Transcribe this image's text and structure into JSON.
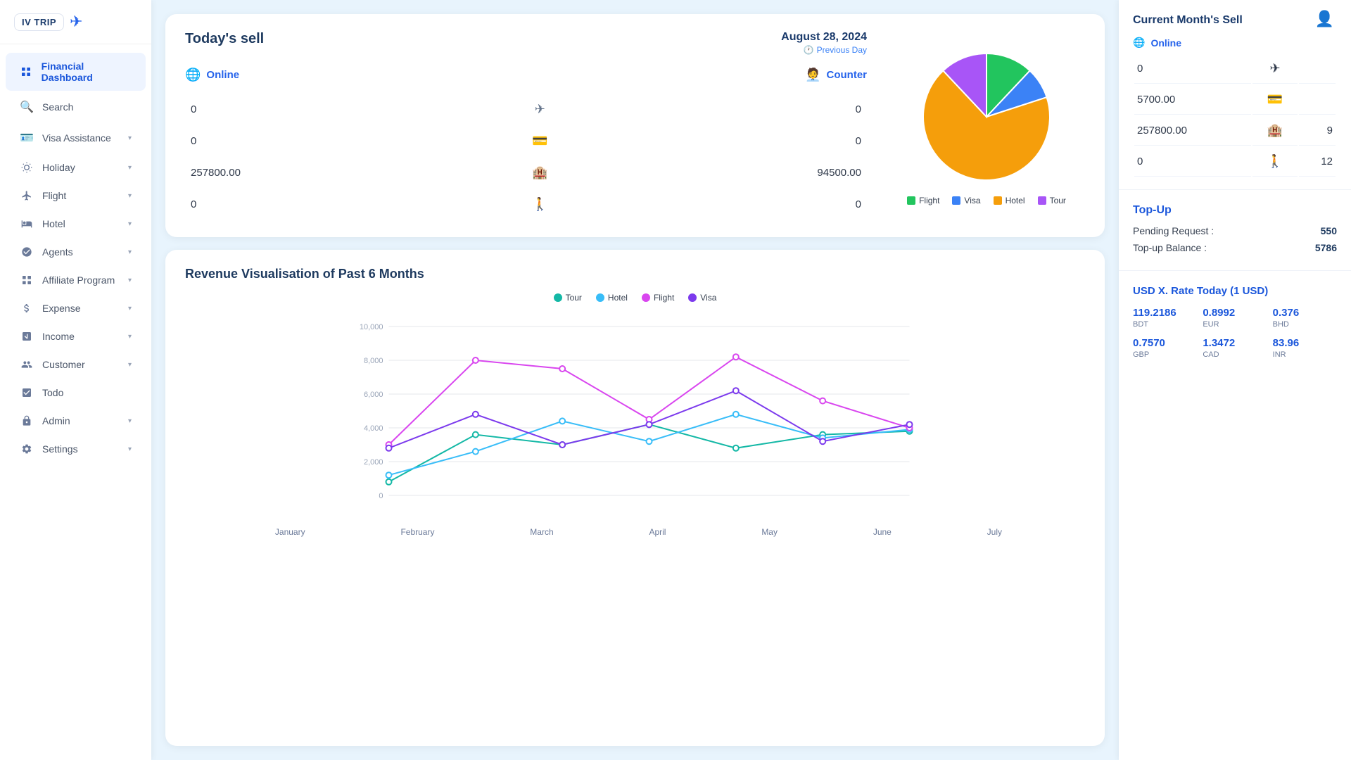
{
  "app": {
    "logo_text": "IV TRIP",
    "logo_icon": "✈"
  },
  "sidebar": {
    "items": [
      {
        "id": "financial-dashboard",
        "label": "Financial Dashboard",
        "icon": "▦",
        "active": true,
        "chevron": false
      },
      {
        "id": "search",
        "label": "Search",
        "icon": "🔍",
        "active": false,
        "chevron": false
      },
      {
        "id": "visa-assistance",
        "label": "Visa Assistance",
        "icon": "✈",
        "active": false,
        "chevron": true
      },
      {
        "id": "holiday",
        "label": "Holiday",
        "icon": "🌴",
        "active": false,
        "chevron": true
      },
      {
        "id": "flight",
        "label": "Flight",
        "icon": "✈",
        "active": false,
        "chevron": true
      },
      {
        "id": "hotel",
        "label": "Hotel",
        "icon": "🏨",
        "active": false,
        "chevron": true
      },
      {
        "id": "agents",
        "label": "Agents",
        "icon": "👤",
        "active": false,
        "chevron": true
      },
      {
        "id": "affiliate-program",
        "label": "Affiliate Program",
        "icon": "▦",
        "active": false,
        "chevron": true
      },
      {
        "id": "expense",
        "label": "Expense",
        "icon": "💲",
        "active": false,
        "chevron": true
      },
      {
        "id": "income",
        "label": "Income",
        "icon": "📥",
        "active": false,
        "chevron": true
      },
      {
        "id": "customer",
        "label": "Customer",
        "icon": "👥",
        "active": false,
        "chevron": true
      },
      {
        "id": "todo",
        "label": "Todo",
        "icon": "☑",
        "active": false,
        "chevron": false
      },
      {
        "id": "admin",
        "label": "Admin",
        "icon": "🔒",
        "active": false,
        "chevron": true
      },
      {
        "id": "settings",
        "label": "Settings",
        "icon": "⚙",
        "active": false,
        "chevron": true
      }
    ]
  },
  "todays_sell": {
    "title": "Today's sell",
    "date": "August 28, 2024",
    "prev_day_label": "Previous Day",
    "online_label": "Online",
    "counter_label": "Counter",
    "rows": [
      {
        "online_val": "0",
        "counter_val": "0",
        "icon": "✈"
      },
      {
        "online_val": "0",
        "counter_val": "0",
        "icon": "VISA"
      },
      {
        "online_val": "257800.00",
        "counter_val": "94500.00",
        "icon": "🏨"
      },
      {
        "online_val": "0",
        "counter_val": "0",
        "icon": "🧑‍🤝‍🧑"
      }
    ]
  },
  "pie_chart": {
    "segments": [
      {
        "label": "Flight",
        "color": "#22c55e",
        "percent": 12
      },
      {
        "label": "Visa",
        "color": "#3b82f6",
        "percent": 8
      },
      {
        "label": "Hotel",
        "color": "#f59e0b",
        "percent": 68
      },
      {
        "label": "Tour",
        "color": "#a855f7",
        "percent": 12
      }
    ]
  },
  "revenue": {
    "title": "Revenue Visualisation of Past 6 Months",
    "legend": [
      {
        "label": "Tour",
        "color": "#14b8a6"
      },
      {
        "label": "Hotel",
        "color": "#38bdf8"
      },
      {
        "label": "Flight",
        "color": "#d946ef"
      },
      {
        "label": "Visa",
        "color": "#7c3aed"
      }
    ],
    "months": [
      "January",
      "February",
      "March",
      "April",
      "May",
      "June",
      "July"
    ],
    "y_labels": [
      "0",
      "2,000",
      "4,000",
      "6,000",
      "8,000",
      "10,000"
    ],
    "series": {
      "tour": [
        800,
        3600,
        3000,
        4200,
        2800,
        3600,
        3800
      ],
      "hotel": [
        1200,
        2600,
        4400,
        3200,
        4800,
        3400,
        3900
      ],
      "flight": [
        3000,
        8000,
        7500,
        4500,
        8200,
        5600,
        4000
      ],
      "visa": [
        2800,
        4800,
        3000,
        4200,
        6200,
        3200,
        4200
      ]
    }
  },
  "current_month_sell": {
    "title": "Current Month's Sell",
    "online_label": "Online",
    "rows": [
      {
        "val": "0",
        "icon": "✈",
        "right_val": ""
      },
      {
        "val": "5700.00",
        "icon": "VISA",
        "right_val": ""
      },
      {
        "val": "257800.00",
        "icon": "🏨",
        "right_val": "9"
      },
      {
        "val": "0",
        "icon": "🧑‍🤝‍🧑",
        "right_val": "12"
      }
    ]
  },
  "topup": {
    "title": "Top-Up",
    "pending_label": "Pending Request :",
    "pending_val": "550",
    "balance_label": "Top-up Balance :",
    "balance_val": "5786"
  },
  "usd": {
    "title": "USD X. Rate Today (1 USD)",
    "rates": [
      {
        "val": "119.2186",
        "currency": "BDT"
      },
      {
        "val": "0.8992",
        "currency": "EUR"
      },
      {
        "val": "0.376",
        "currency": "BHD"
      },
      {
        "val": "0.7570",
        "currency": "GBP"
      },
      {
        "val": "1.3472",
        "currency": "CAD"
      },
      {
        "val": "83.96",
        "currency": "INR"
      }
    ]
  }
}
